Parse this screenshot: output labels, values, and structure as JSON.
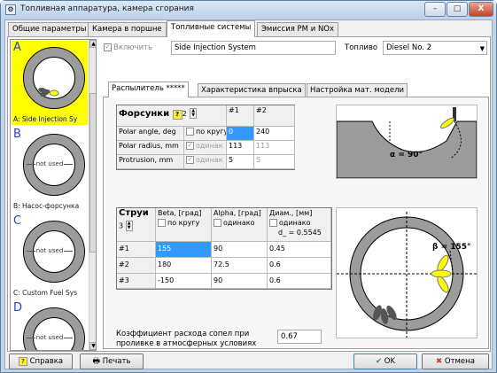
{
  "window": {
    "title": "Топливная аппаратура, камера сгорания",
    "minimize": "–",
    "maximize": "□",
    "close": "X"
  },
  "tabs": [
    "Общие параметры",
    "Камера в поршне",
    "Топливные системы",
    "Эмиссия PM и NOx"
  ],
  "left_list": {
    "items": [
      {
        "letter": "A",
        "caption": "A: Side Injection Sy",
        "not_used": ""
      },
      {
        "letter": "B",
        "caption": "B: Насос-форсунка",
        "not_used": "not used"
      },
      {
        "letter": "C",
        "caption": "C: Custom Fuel Sys",
        "not_used": "not used"
      },
      {
        "letter": "D",
        "caption": "",
        "not_used": "not used"
      }
    ]
  },
  "top": {
    "enable_label": "Включить",
    "system_name": "Side Injection System",
    "fuel_label": "Топливо",
    "fuel_value": "Diesel No. 2"
  },
  "subtabs": [
    "Распылитель *****",
    "Характеристика впрыска",
    "Настройка мат. модели"
  ],
  "injectors": {
    "title": "Форсунки",
    "help": "?",
    "count": "2",
    "col1": "#1",
    "col2": "#2",
    "rows": [
      {
        "name": "Polar angle, deg",
        "opt": "по кругу",
        "v1": "0",
        "v2": "240"
      },
      {
        "name": "Polar radius, mm",
        "opt": "одинак",
        "v1": "113",
        "v2": "113"
      },
      {
        "name": "Protrusion, mm",
        "opt": "одинак",
        "v1": "5",
        "v2": "5"
      }
    ]
  },
  "jets": {
    "title": "Струи",
    "count": "3",
    "beta_h": "Beta, [град]",
    "beta_opt": "по кругу",
    "alpha_h": "Alpha, [град]",
    "alpha_opt": "одинако",
    "diam_h": "Диам., [мм]",
    "diam_opt": "одинако",
    "diam_sub": "d_ = 0.5545",
    "rows": [
      {
        "n": "#1",
        "beta": "155",
        "alpha": "90",
        "d": "0.45"
      },
      {
        "n": "#2",
        "beta": "180",
        "alpha": "72.5",
        "d": "0.6"
      },
      {
        "n": "#3",
        "beta": "-150",
        "alpha": "90",
        "d": "0.6"
      }
    ]
  },
  "coef": {
    "label_1": "Коэффициент расхода сопел при",
    "label_2": "проливке в атмосферных условиях",
    "value": "0.67"
  },
  "diagrams": {
    "alpha_label": "α = 90°",
    "beta_label": "β = 155°"
  },
  "buttons": {
    "help": "Справка",
    "print": "Печать",
    "ok": "OK",
    "cancel": "Отмена"
  }
}
